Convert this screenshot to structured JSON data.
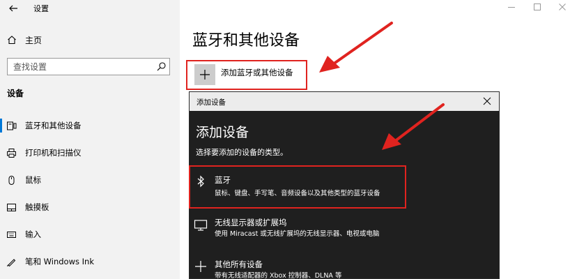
{
  "window": {
    "title": "设置"
  },
  "sidebar": {
    "home_label": "主页",
    "search_placeholder": "查找设置",
    "section_label": "设备",
    "items": [
      {
        "label": "蓝牙和其他设备",
        "icon": "bluetooth-devices-icon",
        "selected": true
      },
      {
        "label": "打印机和扫描仪",
        "icon": "printer-icon",
        "selected": false
      },
      {
        "label": "鼠标",
        "icon": "mouse-icon",
        "selected": false
      },
      {
        "label": "触摸板",
        "icon": "touchpad-icon",
        "selected": false
      },
      {
        "label": "输入",
        "icon": "keyboard-icon",
        "selected": false
      },
      {
        "label": "笔和 Windows Ink",
        "icon": "pen-icon",
        "selected": false
      }
    ]
  },
  "main": {
    "page_title": "蓝牙和其他设备",
    "add_device_label": "添加蓝牙或其他设备"
  },
  "dialog": {
    "header_title": "添加设备",
    "heading": "添加设备",
    "subtitle": "选择要添加的设备的类型。",
    "options": [
      {
        "title": "蓝牙",
        "desc": "鼠标、键盘、手写笔、音频设备以及其他类型的蓝牙设备",
        "icon": "bluetooth-icon"
      },
      {
        "title": "无线显示器或扩展坞",
        "desc": "使用 Miracast 或无线扩展坞的无线显示器、电视或电脑",
        "icon": "monitor-icon"
      },
      {
        "title": "其他所有设备",
        "desc": "带有无线适配器的 Xbox 控制器、DLNA 等",
        "icon": "plus-icon"
      }
    ]
  },
  "colors": {
    "accent": "#0078d7",
    "highlight_red": "#e0231f",
    "dialog_bg": "#1f1f1f",
    "sidebar_bg": "#f2f2f2"
  }
}
